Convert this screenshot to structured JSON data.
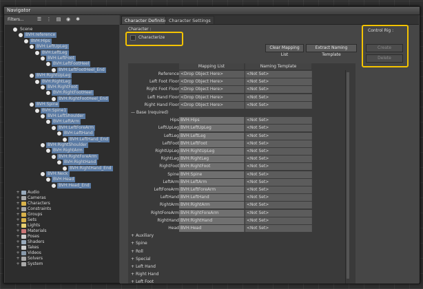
{
  "window": {
    "title": "Navigator"
  },
  "left_panel": {
    "filters_label": "Filters...",
    "toolbar_icons": [
      "list-icon",
      "tree-icon",
      "folder-icon",
      "eye-icon",
      "gear-icon"
    ],
    "tree": [
      {
        "label": "Scene",
        "indent": 0,
        "selected": false,
        "icon": "scene"
      },
      {
        "label": "BVH:reference",
        "indent": 1,
        "selected": true,
        "icon": "node"
      },
      {
        "label": "BVH:Hips",
        "indent": 2,
        "selected": true,
        "icon": "node"
      },
      {
        "label": "BVH:LeftUpLeg",
        "indent": 3,
        "selected": true,
        "icon": "node"
      },
      {
        "label": "BVH:LeftLeg",
        "indent": 4,
        "selected": true,
        "icon": "node"
      },
      {
        "label": "BVH:LeftFoot",
        "indent": 5,
        "selected": true,
        "icon": "node"
      },
      {
        "label": "BVH:LeftFootHeel",
        "indent": 6,
        "selected": true,
        "icon": "node"
      },
      {
        "label": "BVH:LeftFootHeel_End",
        "indent": 7,
        "selected": true,
        "icon": "node"
      },
      {
        "label": "BVH:RightUpLeg",
        "indent": 3,
        "selected": true,
        "icon": "node"
      },
      {
        "label": "BVH:RightLeg",
        "indent": 4,
        "selected": true,
        "icon": "node"
      },
      {
        "label": "BVH:RightFoot",
        "indent": 5,
        "selected": true,
        "icon": "node"
      },
      {
        "label": "BVH:RightFootHeel",
        "indent": 6,
        "selected": true,
        "icon": "node"
      },
      {
        "label": "BVH:RightFootHeel_End",
        "indent": 7,
        "selected": true,
        "icon": "node"
      },
      {
        "label": "BVH:Spine",
        "indent": 3,
        "selected": true,
        "icon": "node"
      },
      {
        "label": "BVH:Spine1",
        "indent": 4,
        "selected": true,
        "icon": "node"
      },
      {
        "label": "BVH:LeftShoulder",
        "indent": 5,
        "selected": true,
        "icon": "node"
      },
      {
        "label": "BVH:LeftArm",
        "indent": 6,
        "selected": true,
        "icon": "node"
      },
      {
        "label": "BVH:LeftForeArm",
        "indent": 7,
        "selected": true,
        "icon": "node"
      },
      {
        "label": "BVH:LeftHand",
        "indent": 8,
        "selected": true,
        "icon": "node"
      },
      {
        "label": "BVH:LeftHand_End",
        "indent": 9,
        "selected": true,
        "icon": "node"
      },
      {
        "label": "BVH:RightShoulder",
        "indent": 5,
        "selected": true,
        "icon": "node"
      },
      {
        "label": "BVH:RightArm",
        "indent": 6,
        "selected": true,
        "icon": "node"
      },
      {
        "label": "BVH:RightForeArm",
        "indent": 7,
        "selected": true,
        "icon": "node"
      },
      {
        "label": "BVH:RightHand",
        "indent": 8,
        "selected": true,
        "icon": "node"
      },
      {
        "label": "BVH:RightHand_End",
        "indent": 9,
        "selected": true,
        "icon": "node"
      },
      {
        "label": "BVH:Neck",
        "indent": 5,
        "selected": true,
        "icon": "node"
      },
      {
        "label": "BVH:Head",
        "indent": 6,
        "selected": true,
        "icon": "node"
      },
      {
        "label": "BVH:Head_End",
        "indent": 7,
        "selected": true,
        "icon": "node"
      }
    ],
    "categories": [
      {
        "label": "Audio",
        "icon": "audio-icon",
        "color": "#9ab"
      },
      {
        "label": "Cameras",
        "icon": "camera-icon",
        "color": "#aaa"
      },
      {
        "label": "Characters",
        "icon": "character-icon",
        "color": "#d9b24a"
      },
      {
        "label": "Constraints",
        "icon": "constraint-icon",
        "color": "#aaa"
      },
      {
        "label": "Groups",
        "icon": "group-icon",
        "color": "#d9b24a"
      },
      {
        "label": "Sets",
        "icon": "set-icon",
        "color": "#d9b24a"
      },
      {
        "label": "Lights",
        "icon": "light-icon",
        "color": "#e8d070"
      },
      {
        "label": "Materials",
        "icon": "material-icon",
        "color": "#c77"
      },
      {
        "label": "Poses",
        "icon": "pose-icon",
        "color": "#ccc"
      },
      {
        "label": "Shaders",
        "icon": "shader-icon",
        "color": "#9ab"
      },
      {
        "label": "Takes",
        "icon": "take-icon",
        "color": "#ccc"
      },
      {
        "label": "Videos",
        "icon": "video-icon",
        "color": "#89a"
      },
      {
        "label": "Solvers",
        "icon": "solver-icon",
        "color": "#aaa"
      },
      {
        "label": "System",
        "icon": "system-icon",
        "color": "#aaa"
      }
    ]
  },
  "tabs": [
    {
      "label": "Character Definition",
      "active": true
    },
    {
      "label": "Character Settings",
      "active": false
    }
  ],
  "character": {
    "group_label": "Character :",
    "characterize_label": "Characterize",
    "characterize_checked": false
  },
  "buttons": {
    "clear_mapping": "Clear Mapping List",
    "extract_naming": "Extract Naming Template"
  },
  "control_rig": {
    "group_label": "Control Rig :",
    "create_label": "Create",
    "delete_label": "Delete"
  },
  "table": {
    "headers": [
      "Mapping List",
      "Naming Template"
    ],
    "reference_rows": [
      {
        "label": "Reference",
        "mapping": "<Drop Object Here>",
        "naming": "<Not Set>"
      },
      {
        "label": "Left Foot Floor",
        "mapping": "<Drop Object Here>",
        "naming": "<Not Set>"
      },
      {
        "label": "Right Foot Floor",
        "mapping": "<Drop Object Here>",
        "naming": "<Not Set>"
      },
      {
        "label": "Left Hand Floor",
        "mapping": "<Drop Object Here>",
        "naming": "<Not Set>"
      },
      {
        "label": "Right Hand Floor",
        "mapping": "<Drop Object Here>",
        "naming": "<Not Set>"
      }
    ],
    "base_section": "Base (required)",
    "base_rows": [
      {
        "label": "Hips",
        "mapping": "BVH:Hips",
        "naming": "<Not Set>"
      },
      {
        "label": "LeftUpLeg",
        "mapping": "BVH:LeftUpLeg",
        "naming": "<Not Set>"
      },
      {
        "label": "LeftLeg",
        "mapping": "BVH:LeftLeg",
        "naming": "<Not Set>"
      },
      {
        "label": "LeftFoot",
        "mapping": "BVH:LeftFoot",
        "naming": "<Not Set>"
      },
      {
        "label": "RightUpLeg",
        "mapping": "BVH:RightUpLeg",
        "naming": "<Not Set>"
      },
      {
        "label": "RightLeg",
        "mapping": "BVH:RightLeg",
        "naming": "<Not Set>"
      },
      {
        "label": "RightFoot",
        "mapping": "BVH:RightFoot",
        "naming": "<Not Set>"
      },
      {
        "label": "Spine",
        "mapping": "BVH:Spine",
        "naming": "<Not Set>"
      },
      {
        "label": "LeftArm",
        "mapping": "BVH:LeftArm",
        "naming": "<Not Set>"
      },
      {
        "label": "LeftForeArm",
        "mapping": "BVH:LeftForeArm",
        "naming": "<Not Set>"
      },
      {
        "label": "LeftHand",
        "mapping": "BVH:LeftHand",
        "naming": "<Not Set>"
      },
      {
        "label": "RightArm",
        "mapping": "BVH:RightArm",
        "naming": "<Not Set>"
      },
      {
        "label": "RightForeArm",
        "mapping": "BVH:RightForeArm",
        "naming": "<Not Set>"
      },
      {
        "label": "RightHand",
        "mapping": "BVH:RightHand",
        "naming": "<Not Set>"
      },
      {
        "label": "Head",
        "mapping": "BVH:Head",
        "naming": "<Not Set>"
      }
    ],
    "collapsed_sections": [
      "Auxiliary",
      "Spine",
      "Roll",
      "Special",
      "Left Hand",
      "Right Hand",
      "Left Foot"
    ]
  },
  "colors": {
    "selection": "#5b7ba4",
    "highlight": "#f5c400"
  }
}
